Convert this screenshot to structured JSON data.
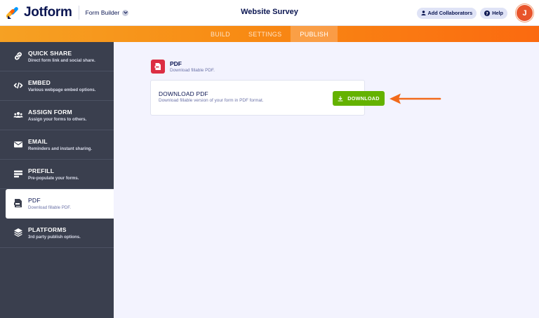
{
  "header": {
    "logo_text": "Jotform",
    "builder_label": "Form Builder",
    "form_title": "Website Survey",
    "add_collaborators_label": "Add Collaborators",
    "help_label": "Help",
    "avatar_initial": "J"
  },
  "tabs": [
    {
      "label": "BUILD",
      "active": false
    },
    {
      "label": "SETTINGS",
      "active": false
    },
    {
      "label": "PUBLISH",
      "active": true
    }
  ],
  "sidebar": {
    "items": [
      {
        "title": "QUICK SHARE",
        "desc": "Direct form link and social share.",
        "icon": "link-icon"
      },
      {
        "title": "EMBED",
        "desc": "Various webpage embed options.",
        "icon": "code-icon"
      },
      {
        "title": "ASSIGN FORM",
        "desc": "Assign your forms to others.",
        "icon": "users-icon"
      },
      {
        "title": "EMAIL",
        "desc": "Reminders and instant sharing.",
        "icon": "envelope-icon"
      },
      {
        "title": "PREFILL",
        "desc": "Pre-populate your forms.",
        "icon": "prefill-icon"
      },
      {
        "title": "PDF",
        "desc": "Download fillable PDF.",
        "icon": "pdf-icon",
        "active": true
      },
      {
        "title": "PLATFORMS",
        "desc": "3rd party publish options.",
        "icon": "layers-icon"
      }
    ]
  },
  "main": {
    "section_title": "PDF",
    "section_desc": "Download fillable PDF.",
    "card_title": "DOWNLOAD PDF",
    "card_desc": "Download fillable version of your form in PDF format.",
    "download_label": "DOWNLOAD"
  },
  "colors": {
    "accent_orange": "#f88b14",
    "sidebar_bg": "#3a3f4e",
    "download_green": "#64b200",
    "pdf_red": "#dc2e43",
    "navy": "#0a1551",
    "arrow": "#f26a1b"
  }
}
